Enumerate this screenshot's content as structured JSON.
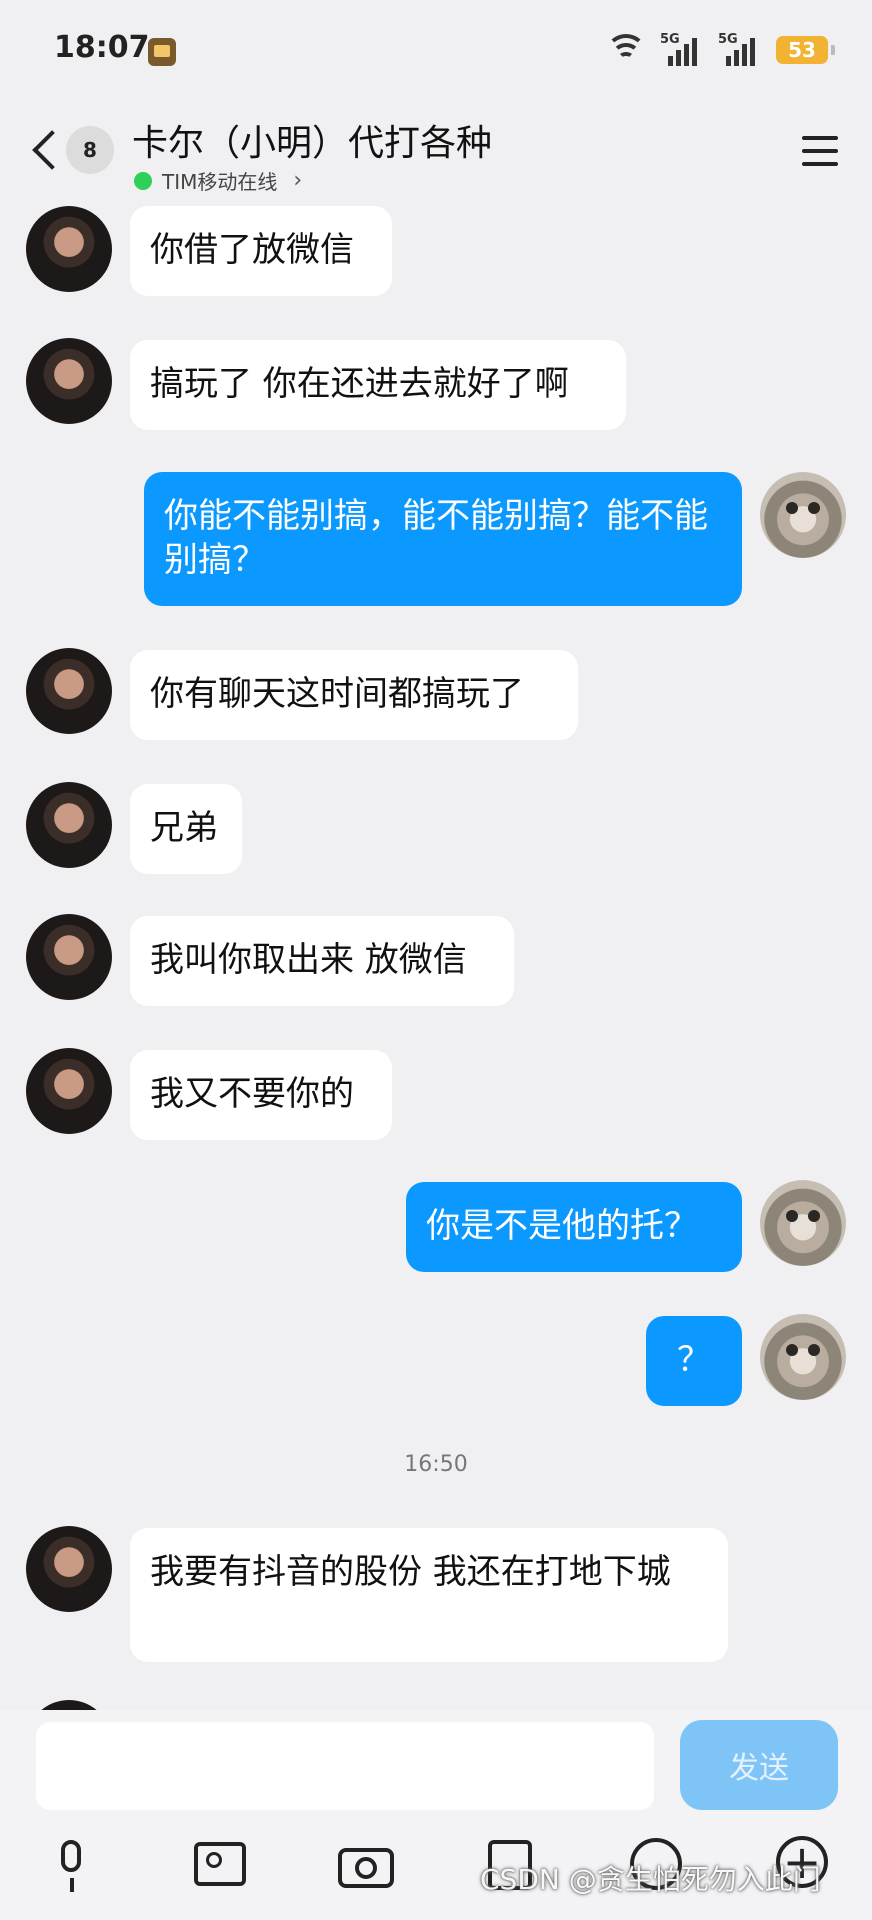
{
  "status_bar": {
    "time": "18:07",
    "network_1": "5G",
    "network_2": "5G",
    "battery": "53"
  },
  "header": {
    "unread_count": "8",
    "title": "卡尔（小明）代打各种",
    "presence": "TIM移动在线",
    "presence_color": "#2ed05a"
  },
  "messages": [
    {
      "from": "friend",
      "text": "你借了放微信"
    },
    {
      "from": "friend",
      "text": "搞玩了 你在还进去就好了啊"
    },
    {
      "from": "me",
      "text": "你能不能别搞，能不能别搞？能不能别搞？"
    },
    {
      "from": "friend",
      "text": "你有聊天这时间都搞玩了"
    },
    {
      "from": "friend",
      "text": "兄弟"
    },
    {
      "from": "friend",
      "text": "我叫你取出来 放微信"
    },
    {
      "from": "friend",
      "text": "我又不要你的"
    },
    {
      "from": "me",
      "text": "你是不是他的托？"
    },
    {
      "from": "me",
      "text": "？"
    },
    {
      "timestamp": "16:50"
    },
    {
      "from": "friend",
      "text": "我要有抖音的股份 我还在打地下城"
    }
  ],
  "composer": {
    "input_value": "",
    "send_label": "发送",
    "tools": [
      "mic-icon",
      "image-icon",
      "camera-icon",
      "red-packet-icon",
      "emoji-icon",
      "plus-icon"
    ]
  },
  "watermark": "CSDN @贪生怕死勿入此门",
  "colors": {
    "outgoing_bubble": "#0b99ff",
    "incoming_bubble": "#ffffff",
    "background": "#f0f0f3",
    "send_button": "#7ec4f7"
  }
}
